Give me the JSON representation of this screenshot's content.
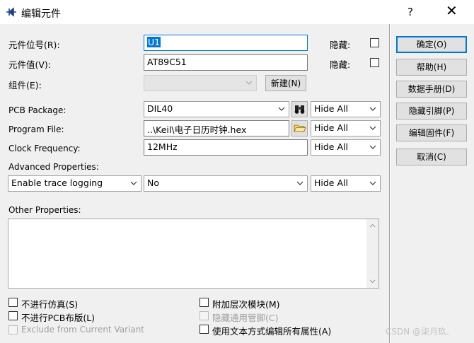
{
  "window": {
    "title": "编辑元件",
    "help": "?",
    "close": "✕"
  },
  "fields": {
    "part_ref": {
      "label": "元件位号(R):",
      "value": "U1",
      "hidden_label": "隐藏:"
    },
    "part_value": {
      "label": "元件值(V):",
      "value": "AT89C51",
      "hidden_label": "隐藏:"
    },
    "component": {
      "label": "组件(E):",
      "new_button": "新建(N)"
    },
    "pcb_package": {
      "label": "PCB Package:",
      "value": "DIL40",
      "visibility": "Hide All"
    },
    "program_file": {
      "label": "Program File:",
      "value": "..\\Keil\\电子日历时钟.hex",
      "visibility": "Hide All"
    },
    "clock_frequency": {
      "label": "Clock Frequency:",
      "value": "12MHz",
      "visibility": "Hide All"
    },
    "advanced": {
      "label": "Advanced Properties:",
      "property": "Enable trace logging",
      "value": "No",
      "visibility": "Hide All"
    },
    "other": {
      "label": "Other Properties:"
    }
  },
  "checkboxes": {
    "no_simulate": "不进行仿真(S)",
    "no_pcb": "不进行PCB布版(L)",
    "exclude_variant": "Exclude from Current Variant",
    "attach_hierarchy": "附加层次模块(M)",
    "hide_common_pins": "隐藏通用管脚(C)",
    "edit_all_as_text": "使用文本方式编辑所有属性(A)"
  },
  "buttons": {
    "ok": "确定(O)",
    "help": "帮助(H)",
    "datasheet": "数据手册(D)",
    "hidden_pins": "隐藏引脚(P)",
    "edit_firmware": "编辑固件(F)",
    "cancel": "取消(C)"
  },
  "watermark": "CSDN @柒月玖."
}
